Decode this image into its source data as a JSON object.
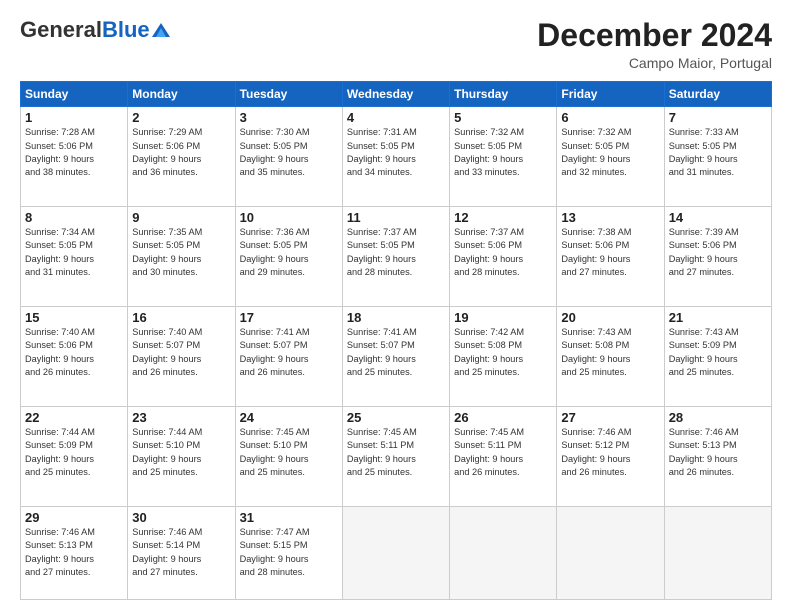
{
  "header": {
    "logo_general": "General",
    "logo_blue": "Blue",
    "month_title": "December 2024",
    "location": "Campo Maior, Portugal"
  },
  "calendar": {
    "weekdays": [
      "Sunday",
      "Monday",
      "Tuesday",
      "Wednesday",
      "Thursday",
      "Friday",
      "Saturday"
    ],
    "weeks": [
      [
        {
          "day": null,
          "info": ""
        },
        {
          "day": "2",
          "info": "Sunrise: 7:29 AM\nSunset: 5:06 PM\nDaylight: 9 hours\nand 36 minutes."
        },
        {
          "day": "3",
          "info": "Sunrise: 7:30 AM\nSunset: 5:05 PM\nDaylight: 9 hours\nand 35 minutes."
        },
        {
          "day": "4",
          "info": "Sunrise: 7:31 AM\nSunset: 5:05 PM\nDaylight: 9 hours\nand 34 minutes."
        },
        {
          "day": "5",
          "info": "Sunrise: 7:32 AM\nSunset: 5:05 PM\nDaylight: 9 hours\nand 33 minutes."
        },
        {
          "day": "6",
          "info": "Sunrise: 7:32 AM\nSunset: 5:05 PM\nDaylight: 9 hours\nand 32 minutes."
        },
        {
          "day": "7",
          "info": "Sunrise: 7:33 AM\nSunset: 5:05 PM\nDaylight: 9 hours\nand 31 minutes."
        }
      ],
      [
        {
          "day": "1",
          "info": "Sunrise: 7:28 AM\nSunset: 5:06 PM\nDaylight: 9 hours\nand 38 minutes."
        },
        {
          "day": null,
          "info": ""
        },
        {
          "day": null,
          "info": ""
        },
        {
          "day": null,
          "info": ""
        },
        {
          "day": null,
          "info": ""
        },
        {
          "day": null,
          "info": ""
        },
        {
          "day": null,
          "info": ""
        }
      ],
      [
        {
          "day": "8",
          "info": "Sunrise: 7:34 AM\nSunset: 5:05 PM\nDaylight: 9 hours\nand 31 minutes."
        },
        {
          "day": "9",
          "info": "Sunrise: 7:35 AM\nSunset: 5:05 PM\nDaylight: 9 hours\nand 30 minutes."
        },
        {
          "day": "10",
          "info": "Sunrise: 7:36 AM\nSunset: 5:05 PM\nDaylight: 9 hours\nand 29 minutes."
        },
        {
          "day": "11",
          "info": "Sunrise: 7:37 AM\nSunset: 5:05 PM\nDaylight: 9 hours\nand 28 minutes."
        },
        {
          "day": "12",
          "info": "Sunrise: 7:37 AM\nSunset: 5:06 PM\nDaylight: 9 hours\nand 28 minutes."
        },
        {
          "day": "13",
          "info": "Sunrise: 7:38 AM\nSunset: 5:06 PM\nDaylight: 9 hours\nand 27 minutes."
        },
        {
          "day": "14",
          "info": "Sunrise: 7:39 AM\nSunset: 5:06 PM\nDaylight: 9 hours\nand 27 minutes."
        }
      ],
      [
        {
          "day": "15",
          "info": "Sunrise: 7:40 AM\nSunset: 5:06 PM\nDaylight: 9 hours\nand 26 minutes."
        },
        {
          "day": "16",
          "info": "Sunrise: 7:40 AM\nSunset: 5:07 PM\nDaylight: 9 hours\nand 26 minutes."
        },
        {
          "day": "17",
          "info": "Sunrise: 7:41 AM\nSunset: 5:07 PM\nDaylight: 9 hours\nand 26 minutes."
        },
        {
          "day": "18",
          "info": "Sunrise: 7:41 AM\nSunset: 5:07 PM\nDaylight: 9 hours\nand 25 minutes."
        },
        {
          "day": "19",
          "info": "Sunrise: 7:42 AM\nSunset: 5:08 PM\nDaylight: 9 hours\nand 25 minutes."
        },
        {
          "day": "20",
          "info": "Sunrise: 7:43 AM\nSunset: 5:08 PM\nDaylight: 9 hours\nand 25 minutes."
        },
        {
          "day": "21",
          "info": "Sunrise: 7:43 AM\nSunset: 5:09 PM\nDaylight: 9 hours\nand 25 minutes."
        }
      ],
      [
        {
          "day": "22",
          "info": "Sunrise: 7:44 AM\nSunset: 5:09 PM\nDaylight: 9 hours\nand 25 minutes."
        },
        {
          "day": "23",
          "info": "Sunrise: 7:44 AM\nSunset: 5:10 PM\nDaylight: 9 hours\nand 25 minutes."
        },
        {
          "day": "24",
          "info": "Sunrise: 7:45 AM\nSunset: 5:10 PM\nDaylight: 9 hours\nand 25 minutes."
        },
        {
          "day": "25",
          "info": "Sunrise: 7:45 AM\nSunset: 5:11 PM\nDaylight: 9 hours\nand 25 minutes."
        },
        {
          "day": "26",
          "info": "Sunrise: 7:45 AM\nSunset: 5:11 PM\nDaylight: 9 hours\nand 26 minutes."
        },
        {
          "day": "27",
          "info": "Sunrise: 7:46 AM\nSunset: 5:12 PM\nDaylight: 9 hours\nand 26 minutes."
        },
        {
          "day": "28",
          "info": "Sunrise: 7:46 AM\nSunset: 5:13 PM\nDaylight: 9 hours\nand 26 minutes."
        }
      ],
      [
        {
          "day": "29",
          "info": "Sunrise: 7:46 AM\nSunset: 5:13 PM\nDaylight: 9 hours\nand 27 minutes."
        },
        {
          "day": "30",
          "info": "Sunrise: 7:46 AM\nSunset: 5:14 PM\nDaylight: 9 hours\nand 27 minutes."
        },
        {
          "day": "31",
          "info": "Sunrise: 7:47 AM\nSunset: 5:15 PM\nDaylight: 9 hours\nand 28 minutes."
        },
        {
          "day": null,
          "info": ""
        },
        {
          "day": null,
          "info": ""
        },
        {
          "day": null,
          "info": ""
        },
        {
          "day": null,
          "info": ""
        }
      ]
    ]
  }
}
